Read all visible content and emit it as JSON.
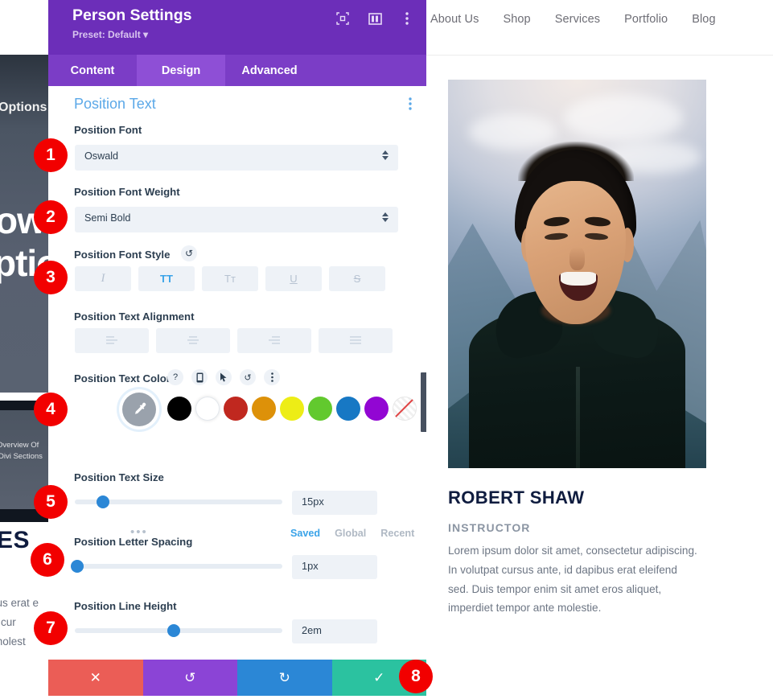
{
  "site_nav": {
    "items": [
      "About Us",
      "Shop",
      "Services",
      "Portfolio",
      "Blog"
    ]
  },
  "background_page": {
    "options_label": "Options",
    "headline_line1": "ow",
    "headline_line2": "ptio",
    "card_caption_line1": "Overview Of",
    "card_caption_line2": "Divi Sections",
    "section_heading": "ES",
    "para_line1": "bus erat e",
    "para_line2": "at cur",
    "para_line3": "molest"
  },
  "modal": {
    "title": "Person Settings",
    "preset": "Preset: Default",
    "header_icons": [
      "focus-icon",
      "layout-icon",
      "kebab-icon"
    ],
    "tabs": [
      {
        "label": "Content",
        "active": false
      },
      {
        "label": "Design",
        "active": true
      },
      {
        "label": "Advanced",
        "active": false
      }
    ],
    "section_title": "Position Text",
    "fields": {
      "font": {
        "label": "Position Font",
        "value": "Oswald"
      },
      "font_weight": {
        "label": "Position Font Weight",
        "value": "Semi Bold"
      },
      "font_style": {
        "label": "Position Font Style",
        "buttons": [
          {
            "name": "italic",
            "glyph": "I",
            "active": false
          },
          {
            "name": "uppercase",
            "glyph": "TT",
            "active": true
          },
          {
            "name": "smallcaps",
            "glyph": "Tᴛ",
            "active": false
          },
          {
            "name": "underline",
            "glyph": "U",
            "active": false
          },
          {
            "name": "strikethrough",
            "glyph": "S",
            "active": false
          }
        ]
      },
      "text_alignment": {
        "label": "Position Text Alignment",
        "buttons": [
          "align-left",
          "align-center",
          "align-right",
          "align-justify"
        ]
      },
      "text_color": {
        "label": "Position Text Color",
        "control_icons": [
          "help-icon",
          "responsive-icon",
          "hover-icon",
          "reset-icon",
          "kebab-icon"
        ],
        "swatches": [
          "#000000",
          "#ffffff",
          "#c0281f",
          "#dd9109",
          "#eded16",
          "#62c92e",
          "#1778c4",
          "#9206d3",
          "transparent"
        ],
        "palette_tabs": [
          {
            "label": "Saved",
            "active": true
          },
          {
            "label": "Global",
            "active": false
          },
          {
            "label": "Recent",
            "active": false
          }
        ],
        "settings_icon": "gear-icon"
      },
      "text_size": {
        "label": "Position Text Size",
        "value": "15px",
        "percent": 12
      },
      "letter_spacing": {
        "label": "Position Letter Spacing",
        "value": "1px",
        "percent": 0
      },
      "line_height": {
        "label": "Position Line Height",
        "value": "2em",
        "percent": 46
      }
    },
    "footer_buttons": [
      {
        "name": "close",
        "glyph": "✕"
      },
      {
        "name": "undo",
        "glyph": "↺"
      },
      {
        "name": "redo",
        "glyph": "↻"
      },
      {
        "name": "save",
        "glyph": "✓"
      }
    ]
  },
  "person_card": {
    "name": "ROBERT SHAW",
    "position": "INSTRUCTOR",
    "description": "Lorem ipsum dolor sit amet, consectetur adipiscing. In volutpat cursus ante, id dapibus erat eleifend sed. Duis tempor enim sit amet eros aliquet, imperdiet tempor ante molestie."
  },
  "annotations": {
    "badges": [
      "1",
      "2",
      "3",
      "4",
      "5",
      "6",
      "7",
      "8"
    ]
  },
  "colors": {
    "modal_header": "#6c2eb9",
    "tab_active": "#8e4fd6",
    "badge_red": "#f20000",
    "accent_blue": "#3aa3e8"
  }
}
